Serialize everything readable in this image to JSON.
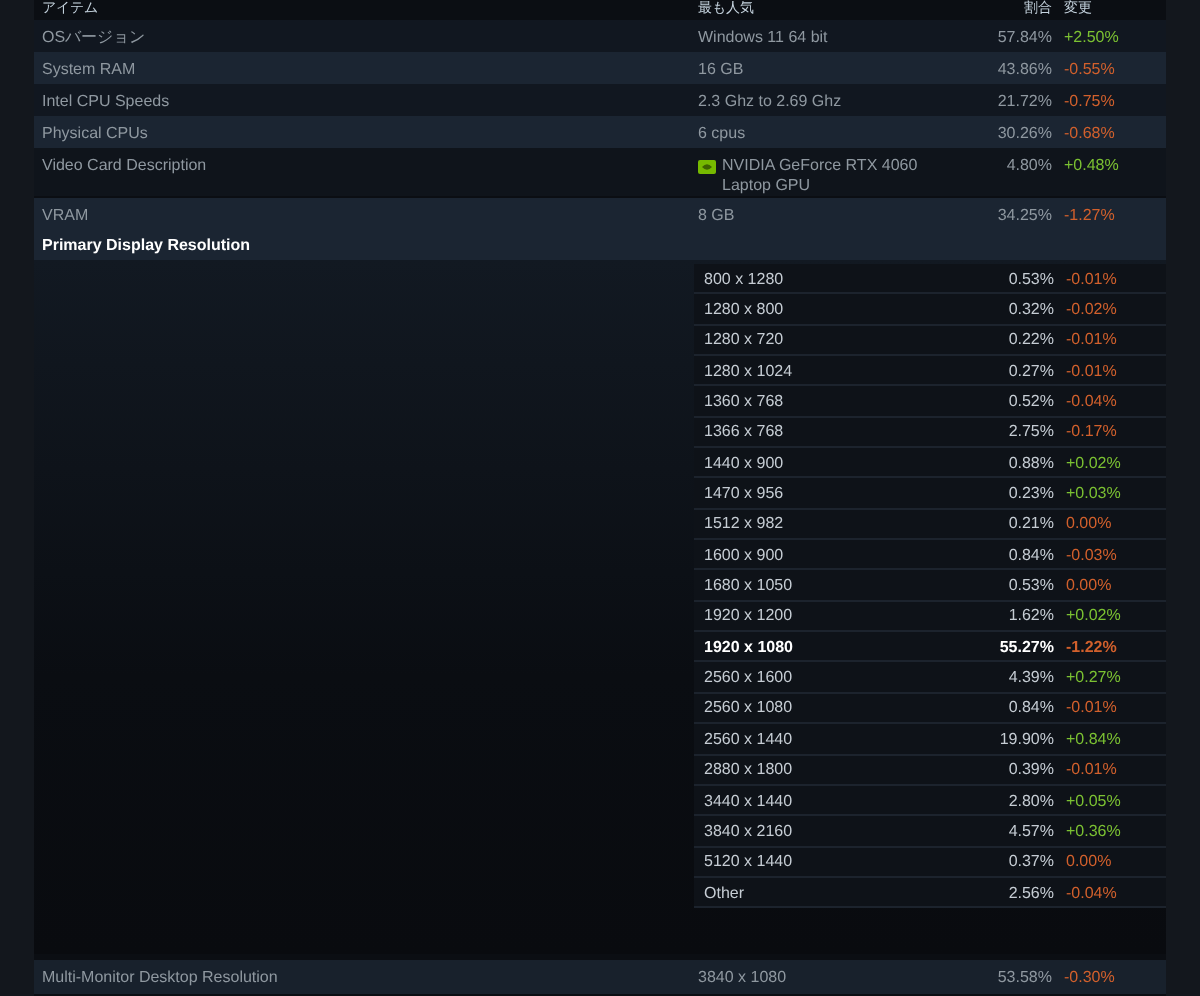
{
  "columns": [
    "アイテム",
    "最も人気",
    "割合",
    "変更"
  ],
  "rows": [
    {
      "kind": "plain",
      "name": "OSバージョン",
      "popular": "Windows 11 64 bit",
      "percent": "57.84%",
      "change": "+2.50%",
      "color": "#7bc132"
    },
    {
      "kind": "plain",
      "name": "System RAM",
      "popular": "16 GB",
      "percent": "43.86%",
      "change": "-0.55%",
      "color": "#d2602c"
    },
    {
      "kind": "plain",
      "name": "Intel CPU Speeds",
      "popular": "2.3 Ghz to 2.69 Ghz",
      "percent": "21.72%",
      "change": "-0.75%",
      "color": "#d2602c"
    },
    {
      "kind": "plain",
      "name": "Physical CPUs",
      "popular": "6 cpus",
      "percent": "30.26%",
      "change": "-0.68%",
      "color": "#d2602c"
    },
    {
      "kind": "gpu",
      "name": "Video Card Description",
      "popular": "NVIDIA GeForce RTX 4060 Laptop GPU",
      "percent": "4.80%",
      "change": "+0.48%",
      "color": "#7bc132"
    },
    {
      "kind": "plain",
      "name": "VRAM",
      "popular": "8 GB",
      "percent": "34.25%",
      "change": "-1.27%",
      "color": "#d2602c"
    }
  ],
  "primary_display": {
    "title": "Primary Display Resolution",
    "rows": [
      {
        "resolution": "800 x 1280",
        "percent": "0.53%",
        "change": "-0.01%",
        "color": "#d2602c",
        "bold": false
      },
      {
        "resolution": "1280 x 800",
        "percent": "0.32%",
        "change": "-0.02%",
        "color": "#d2602c",
        "bold": false
      },
      {
        "resolution": "1280 x 720",
        "percent": "0.22%",
        "change": "-0.01%",
        "color": "#d2602c",
        "bold": false
      },
      {
        "resolution": "1280 x 1024",
        "percent": "0.27%",
        "change": "-0.01%",
        "color": "#d2602c",
        "bold": false
      },
      {
        "resolution": "1360 x 768",
        "percent": "0.52%",
        "change": "-0.04%",
        "color": "#d2602c",
        "bold": false
      },
      {
        "resolution": "1366 x 768",
        "percent": "2.75%",
        "change": "-0.17%",
        "color": "#d2602c",
        "bold": false
      },
      {
        "resolution": "1440 x 900",
        "percent": "0.88%",
        "change": "+0.02%",
        "color": "#7bc132",
        "bold": false
      },
      {
        "resolution": "1470 x 956",
        "percent": "0.23%",
        "change": "+0.03%",
        "color": "#7bc132",
        "bold": false
      },
      {
        "resolution": "1512 x 982",
        "percent": "0.21%",
        "change": "0.00%",
        "color": "#d2602c",
        "bold": false
      },
      {
        "resolution": "1600 x 900",
        "percent": "0.84%",
        "change": "-0.03%",
        "color": "#d2602c",
        "bold": false
      },
      {
        "resolution": "1680 x 1050",
        "percent": "0.53%",
        "change": "0.00%",
        "color": "#d2602c",
        "bold": false
      },
      {
        "resolution": "1920 x 1200",
        "percent": "1.62%",
        "change": "+0.02%",
        "color": "#7bc132",
        "bold": false
      },
      {
        "resolution": "1920 x 1080",
        "percent": "55.27%",
        "change": "-1.22%",
        "color": "#d2602c",
        "bold": true
      },
      {
        "resolution": "2560 x 1600",
        "percent": "4.39%",
        "change": "+0.27%",
        "color": "#7bc132",
        "bold": false
      },
      {
        "resolution": "2560 x 1080",
        "percent": "0.84%",
        "change": "-0.01%",
        "color": "#d2602c",
        "bold": false
      },
      {
        "resolution": "2560 x 1440",
        "percent": "19.90%",
        "change": "+0.84%",
        "color": "#7bc132",
        "bold": false
      },
      {
        "resolution": "2880 x 1800",
        "percent": "0.39%",
        "change": "-0.01%",
        "color": "#d2602c",
        "bold": false
      },
      {
        "resolution": "3440 x 1440",
        "percent": "2.80%",
        "change": "+0.05%",
        "color": "#7bc132",
        "bold": false
      },
      {
        "resolution": "3840 x 2160",
        "percent": "4.57%",
        "change": "+0.36%",
        "color": "#7bc132",
        "bold": false
      },
      {
        "resolution": "5120 x 1440",
        "percent": "0.37%",
        "change": "0.00%",
        "color": "#d2602c",
        "bold": false
      },
      {
        "resolution": "Other",
        "percent": "2.56%",
        "change": "-0.04%",
        "color": "#d2602c",
        "bold": false
      }
    ]
  },
  "footer_row": {
    "name": "Multi-Monitor Desktop Resolution",
    "popular": "3840 x 1080",
    "percent": "53.58%",
    "change": "-0.30%",
    "color": "#d2602c"
  }
}
